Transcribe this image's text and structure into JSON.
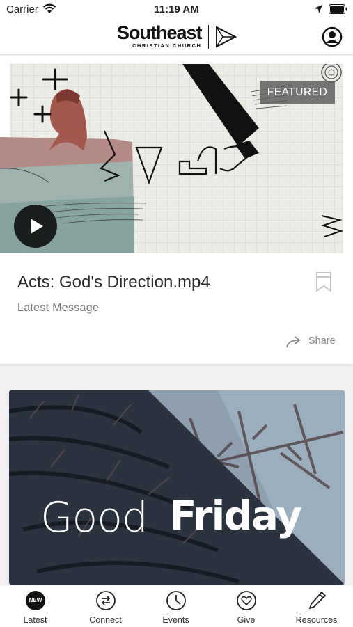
{
  "status_bar": {
    "carrier": "Carrier",
    "time": "11:19 AM"
  },
  "header": {
    "brand_name": "Southeast",
    "brand_sub": "CHRISTIAN CHURCH"
  },
  "featured_card": {
    "badge": "FEATURED",
    "title": "Acts: God's Direction.mp4",
    "subtitle": "Latest Message",
    "share_label": "Share"
  },
  "banner": {
    "word_light": "Good",
    "word_bold": "Friday"
  },
  "tabs": [
    {
      "label": "Latest",
      "icon": "new-badge-icon",
      "badge": "NEW"
    },
    {
      "label": "Connect",
      "icon": "arrows-icon"
    },
    {
      "label": "Events",
      "icon": "clock-icon"
    },
    {
      "label": "Give",
      "icon": "heart-icon"
    },
    {
      "label": "Resources",
      "icon": "pencil-icon"
    }
  ],
  "colors": {
    "text_dark": "#2b2b2b",
    "text_muted": "#777777",
    "tab_icon": "#222222",
    "featured_badge": "#5a5a5a"
  }
}
